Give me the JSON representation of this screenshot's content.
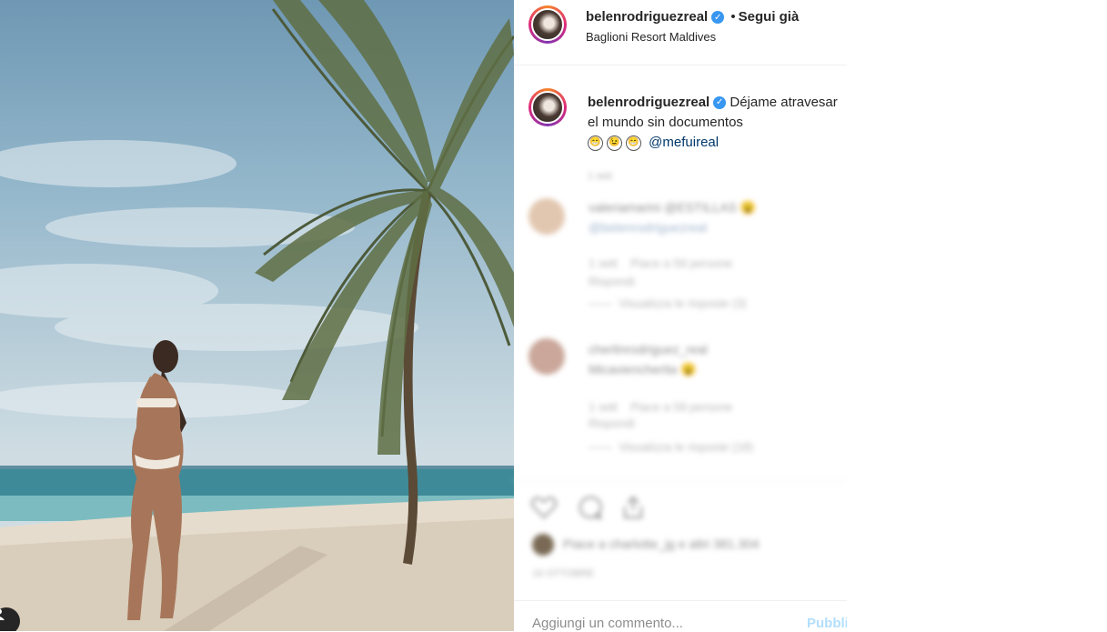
{
  "post": {
    "username": "belenrodriguezreal",
    "follow_separator": "•",
    "follow_label": "Segui già",
    "location": "Baglioni Resort Maldives",
    "caption_username": "belenrodriguezreal",
    "caption_text": "Déjame atravesar el mundo sin documentos",
    "caption_emojis": [
      "😁",
      "😉",
      "😁"
    ],
    "caption_mention": "@mefuireal"
  },
  "blurred_comments": {
    "time_ago": "1 sett",
    "comment1": {
      "username": "valeriamarini",
      "text_tail": "@ESTILLAS 😮",
      "mention": "@belenrodriguezreal",
      "meta_time": "1 sett",
      "meta_likes": "Piace a 59 persone",
      "meta_reply": "Rispondi",
      "view_replies": "Visualizza le risposte (3)"
    },
    "comment2": {
      "username": "cherlinrodriguez_real",
      "text": "Micaviencherita 😮",
      "meta_time": "1 sett",
      "meta_likes": "Piace a 59 persone",
      "meta_reply": "Rispondi",
      "view_replies": "Visualizza le risposte (18)"
    }
  },
  "actions": {
    "like_icon": "heart-icon",
    "comment_icon": "comment-icon",
    "share_icon": "share-icon",
    "likes_text": "Piace a charlotte_jg e altri 381.304",
    "date": "16 OTTOBRE"
  },
  "add_comment": {
    "placeholder": "Aggiungi un commento...",
    "publish_label": "Pubblica"
  },
  "colors": {
    "link": "#00376b",
    "verified": "#3897f0",
    "publish_disabled": "#b2dffc"
  }
}
